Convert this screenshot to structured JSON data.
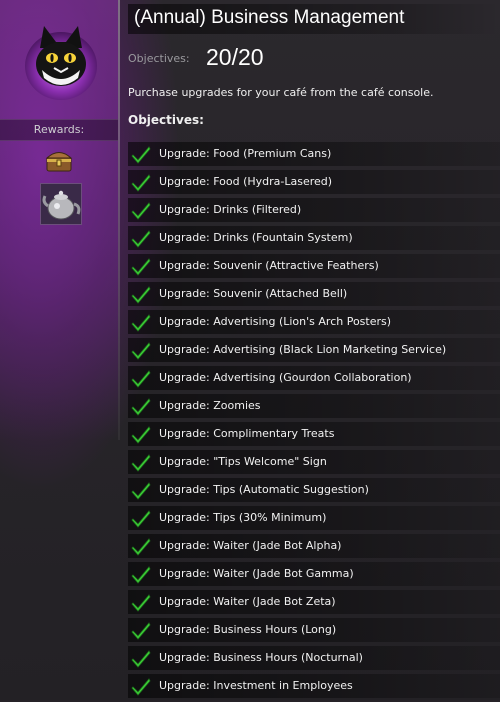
{
  "achievement": {
    "title": "(Annual) Business Management",
    "objectives_label": "Objectives:",
    "objectives_count": "20/20",
    "description": "Purchase upgrades for your café from the café console.",
    "objectives_heading": "Objectives:"
  },
  "sidebar": {
    "rewards_label": "Rewards:",
    "rewards": [
      {
        "icon": "chest-icon"
      },
      {
        "icon": "teapot-icon"
      }
    ]
  },
  "objectives": [
    {
      "label": "Upgrade: Food (Premium Cans)",
      "done": true
    },
    {
      "label": "Upgrade: Food (Hydra-Lasered)",
      "done": true
    },
    {
      "label": "Upgrade: Drinks (Filtered)",
      "done": true
    },
    {
      "label": "Upgrade: Drinks (Fountain System)",
      "done": true
    },
    {
      "label": "Upgrade: Souvenir (Attractive Feathers)",
      "done": true
    },
    {
      "label": "Upgrade: Souvenir (Attached Bell)",
      "done": true
    },
    {
      "label": "Upgrade: Advertising (Lion's Arch Posters)",
      "done": true
    },
    {
      "label": "Upgrade: Advertising (Black Lion Marketing Service)",
      "done": true
    },
    {
      "label": "Upgrade: Advertising (Gourdon Collaboration)",
      "done": true
    },
    {
      "label": "Upgrade: Zoomies",
      "done": true
    },
    {
      "label": "Upgrade: Complimentary Treats",
      "done": true
    },
    {
      "label": "Upgrade: \"Tips Welcome\" Sign",
      "done": true
    },
    {
      "label": "Upgrade: Tips (Automatic Suggestion)",
      "done": true
    },
    {
      "label": "Upgrade: Tips (30% Minimum)",
      "done": true
    },
    {
      "label": "Upgrade: Waiter (Jade Bot Alpha)",
      "done": true
    },
    {
      "label": "Upgrade: Waiter (Jade Bot Gamma)",
      "done": true
    },
    {
      "label": "Upgrade: Waiter (Jade Bot Zeta)",
      "done": true
    },
    {
      "label": "Upgrade: Business Hours (Long)",
      "done": true
    },
    {
      "label": "Upgrade: Business Hours (Nocturnal)",
      "done": true
    },
    {
      "label": "Upgrade: Investment in Employees",
      "done": true
    }
  ],
  "colors": {
    "accent_purple": "#8a2fa8",
    "check_green": "#3fd23a"
  }
}
